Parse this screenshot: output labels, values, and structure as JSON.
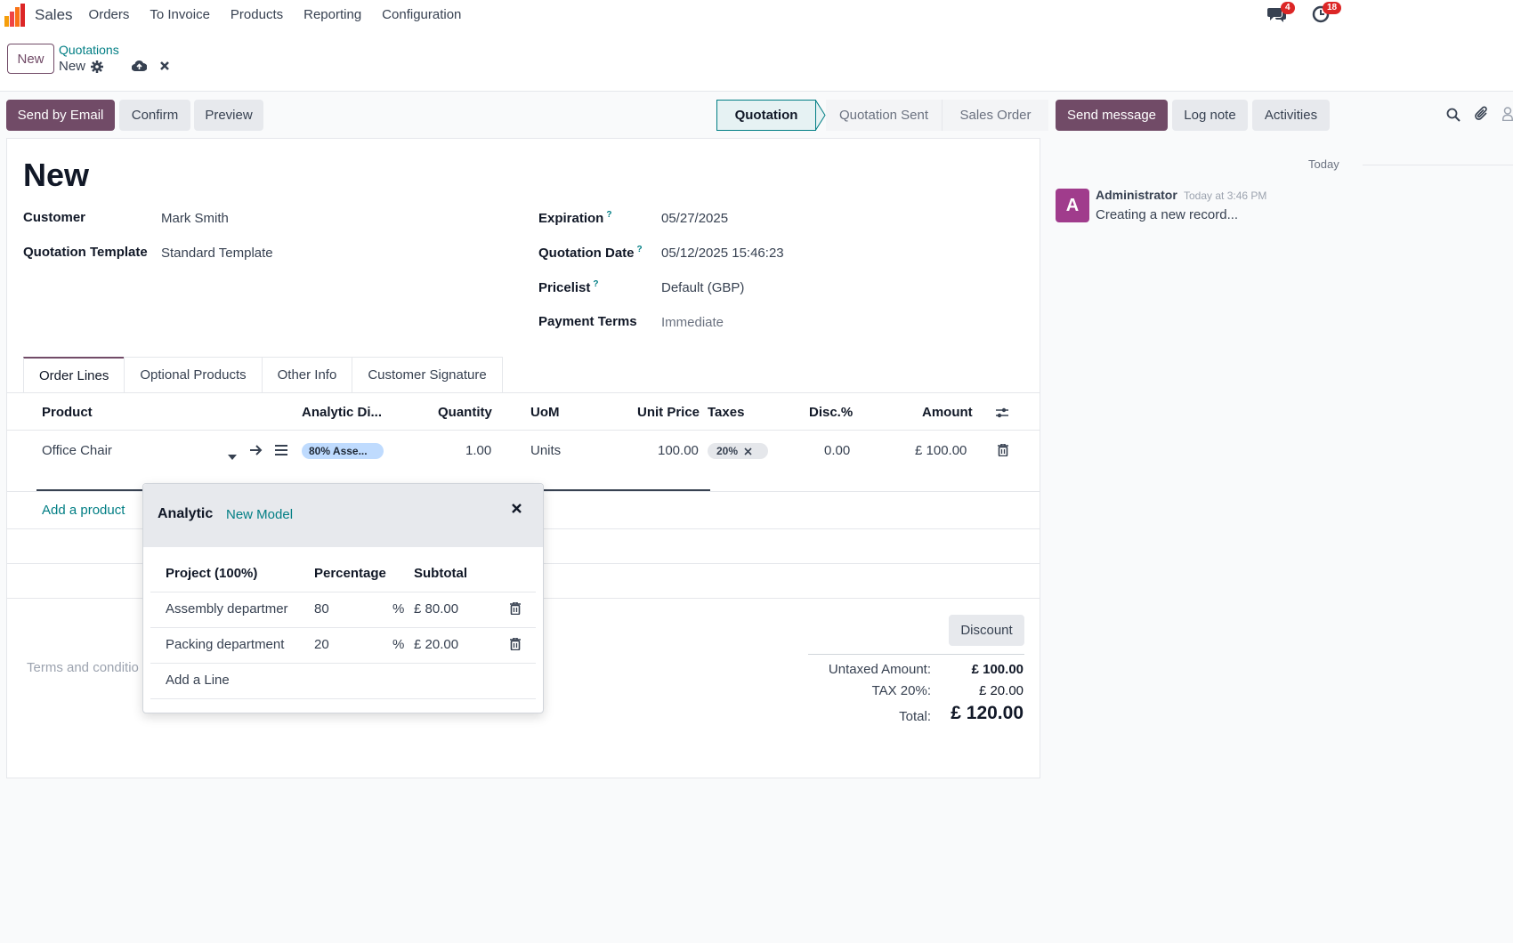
{
  "navbar": {
    "app_name": "Sales",
    "menu": [
      "Orders",
      "To Invoice",
      "Products",
      "Reporting",
      "Configuration"
    ],
    "messages_badge": "4",
    "activities_badge": "18"
  },
  "control_panel": {
    "new_button": "New",
    "breadcrumb": "Quotations",
    "record_name": "New"
  },
  "actions": {
    "send_email": "Send by Email",
    "confirm": "Confirm",
    "preview": "Preview"
  },
  "statusbar": {
    "stages": [
      "Quotation",
      "Quotation Sent",
      "Sales Order"
    ],
    "active": "Quotation"
  },
  "form": {
    "title": "New",
    "customer_label": "Customer",
    "customer_value": "Mark Smith",
    "template_label": "Quotation Template",
    "template_value": "Standard Template",
    "expiration_label": "Expiration",
    "expiration_value": "05/27/2025",
    "quotation_date_label": "Quotation Date",
    "quotation_date_value": "05/12/2025 15:46:23",
    "pricelist_label": "Pricelist",
    "pricelist_value": "Default (GBP)",
    "payment_terms_label": "Payment Terms",
    "payment_terms_placeholder": "Immediate",
    "help_mark": "?"
  },
  "tabs": [
    "Order Lines",
    "Optional Products",
    "Other Info",
    "Customer Signature"
  ],
  "order_lines": {
    "columns": {
      "product": "Product",
      "analytic": "Analytic Di...",
      "quantity": "Quantity",
      "uom": "UoM",
      "unit_price": "Unit Price",
      "taxes": "Taxes",
      "discount": "Disc.%",
      "amount": "Amount"
    },
    "row": {
      "product": "Office Chair",
      "analytic": "80% Asse...",
      "quantity": "1.00",
      "uom": "Units",
      "unit_price": "100.00",
      "tax": "20%",
      "discount": "0.00",
      "amount": "£ 100.00"
    },
    "add_product": "Add a product"
  },
  "terms_placeholder": "Terms and conditio",
  "totals": {
    "discount_button": "Discount",
    "untaxed_label": "Untaxed Amount:",
    "untaxed_value": "£ 100.00",
    "tax_label": "TAX 20%:",
    "tax_value": "£ 20.00",
    "total_label": "Total:",
    "total_value": "£ 120.00"
  },
  "analytic_popover": {
    "title": "Analytic",
    "model": "New Model",
    "col_project": "Project (100%)",
    "col_percentage": "Percentage",
    "col_subtotal": "Subtotal",
    "rows": [
      {
        "account": "Assembly departmer",
        "percentage": "80",
        "unit": "%",
        "subtotal": "£ 80.00"
      },
      {
        "account": "Packing department",
        "percentage": "20",
        "unit": "%",
        "subtotal": "£ 20.00"
      }
    ],
    "add_line": "Add a Line"
  },
  "chatter": {
    "send_message": "Send message",
    "log_note": "Log note",
    "activities": "Activities",
    "today": "Today",
    "author": "Administrator",
    "avatar_letter": "A",
    "date": "Today at 3:46 PM",
    "body": "Creating a new record..."
  },
  "colors": {
    "primary": "#714b67",
    "link": "#017e84",
    "badge": "#dc2626",
    "avatar": "#a03c8c"
  }
}
